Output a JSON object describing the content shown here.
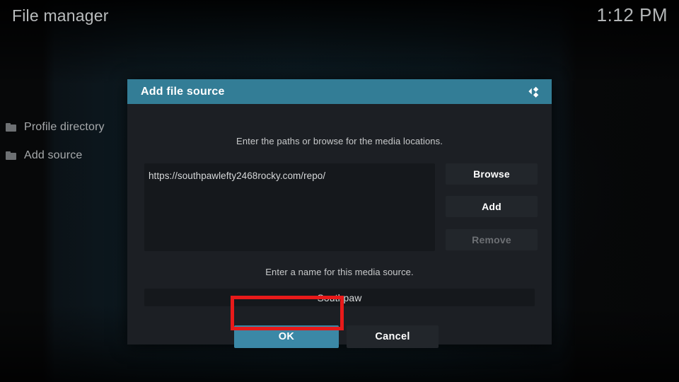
{
  "header": {
    "title": "File manager",
    "clock": "1:12 PM"
  },
  "sidebar": {
    "items": [
      {
        "label": "Profile directory",
        "icon": "folder-icon"
      },
      {
        "label": "Add source",
        "icon": "folder-icon"
      }
    ]
  },
  "dialog": {
    "title": "Add file source",
    "logo_icon": "kodi-logo-icon",
    "paths_hint": "Enter the paths or browse for the media locations.",
    "paths": [
      "https://southpawlefty2468rocky.com/repo/"
    ],
    "side_buttons": [
      {
        "label": "Browse",
        "enabled": true
      },
      {
        "label": "Add",
        "enabled": true
      },
      {
        "label": "Remove",
        "enabled": false
      }
    ],
    "name_hint": "Enter a name for this media source.",
    "name_value": "Southpaw",
    "ok_label": "OK",
    "cancel_label": "Cancel"
  },
  "annotation": {
    "target": "ok-button",
    "color": "#e81a1a"
  },
  "colors": {
    "titlebar": "#337d96",
    "accent_button": "#3b88a6",
    "dialog_bg": "#1c1f24",
    "field_bg": "#15181c",
    "button_bg": "#22262b",
    "disabled_text": "#6d7074",
    "highlight": "#e81a1a"
  }
}
